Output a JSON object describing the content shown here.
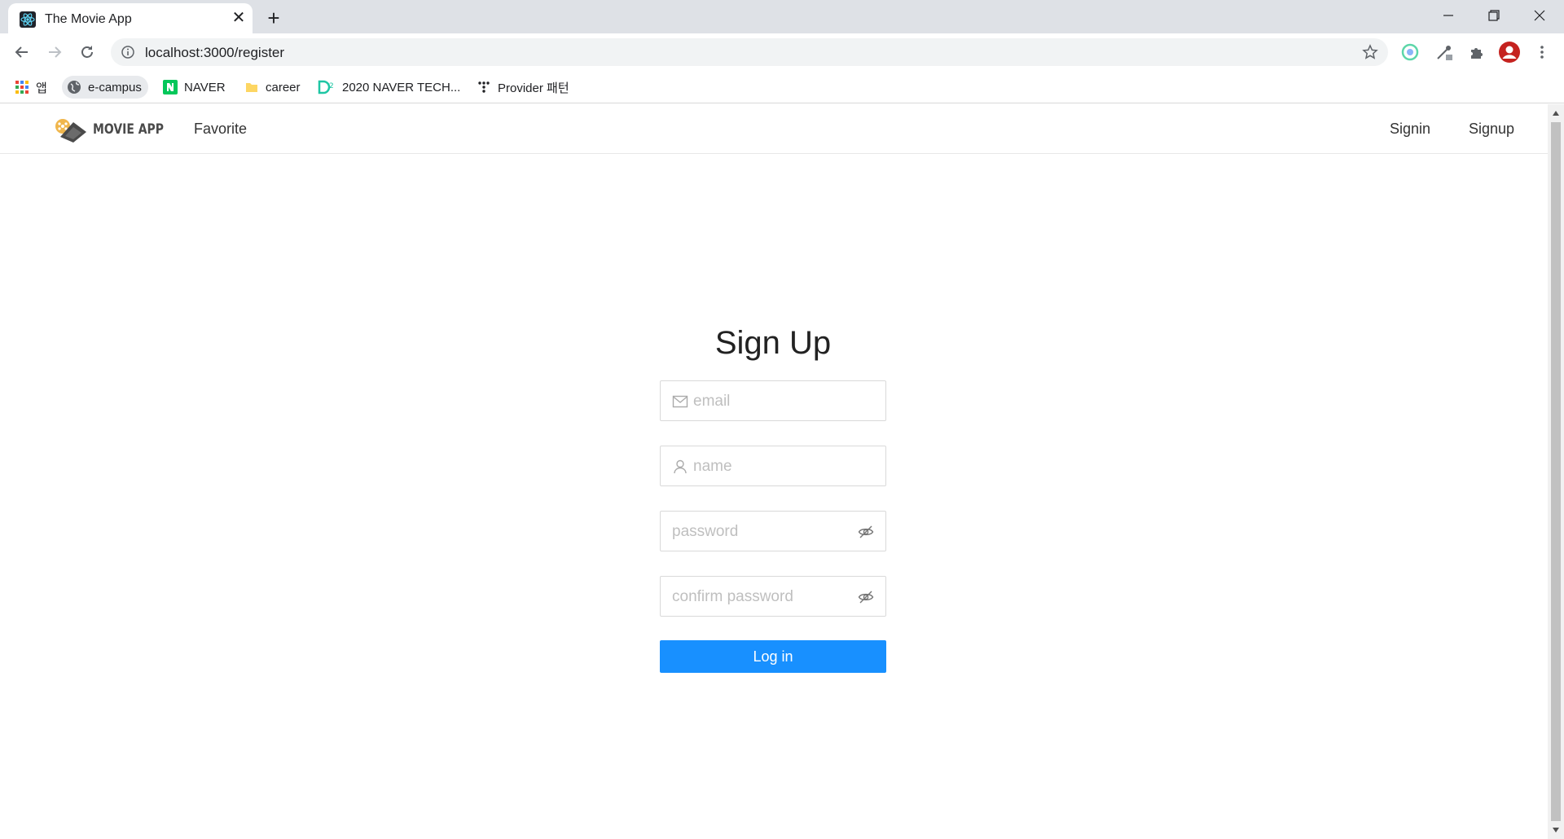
{
  "browser": {
    "tab_title": "The Movie App",
    "tab_close": "✕",
    "new_tab": "+",
    "url": "localhost:3000/register",
    "bookmarks": [
      {
        "label": "앱",
        "icon": "apps-grid-icon"
      },
      {
        "label": "e-campus",
        "icon": "globe-icon"
      },
      {
        "label": "NAVER",
        "icon": "naver-icon"
      },
      {
        "label": "career",
        "icon": "folder-icon"
      },
      {
        "label": "2020 NAVER TECH...",
        "icon": "d2-icon"
      },
      {
        "label": "Provider 패턴",
        "icon": "dots-icon"
      }
    ]
  },
  "app": {
    "logo_text": "MOVIE APP",
    "nav": {
      "favorite": "Favorite",
      "signin": "Signin",
      "signup": "Signup"
    }
  },
  "form": {
    "title": "Sign Up",
    "email_placeholder": "email",
    "name_placeholder": "name",
    "password_placeholder": "password",
    "confirm_placeholder": "confirm password",
    "submit_label": "Log in"
  },
  "colors": {
    "primary": "#1890ff",
    "placeholder": "#bfbfbf",
    "border": "#d9d9d9"
  }
}
